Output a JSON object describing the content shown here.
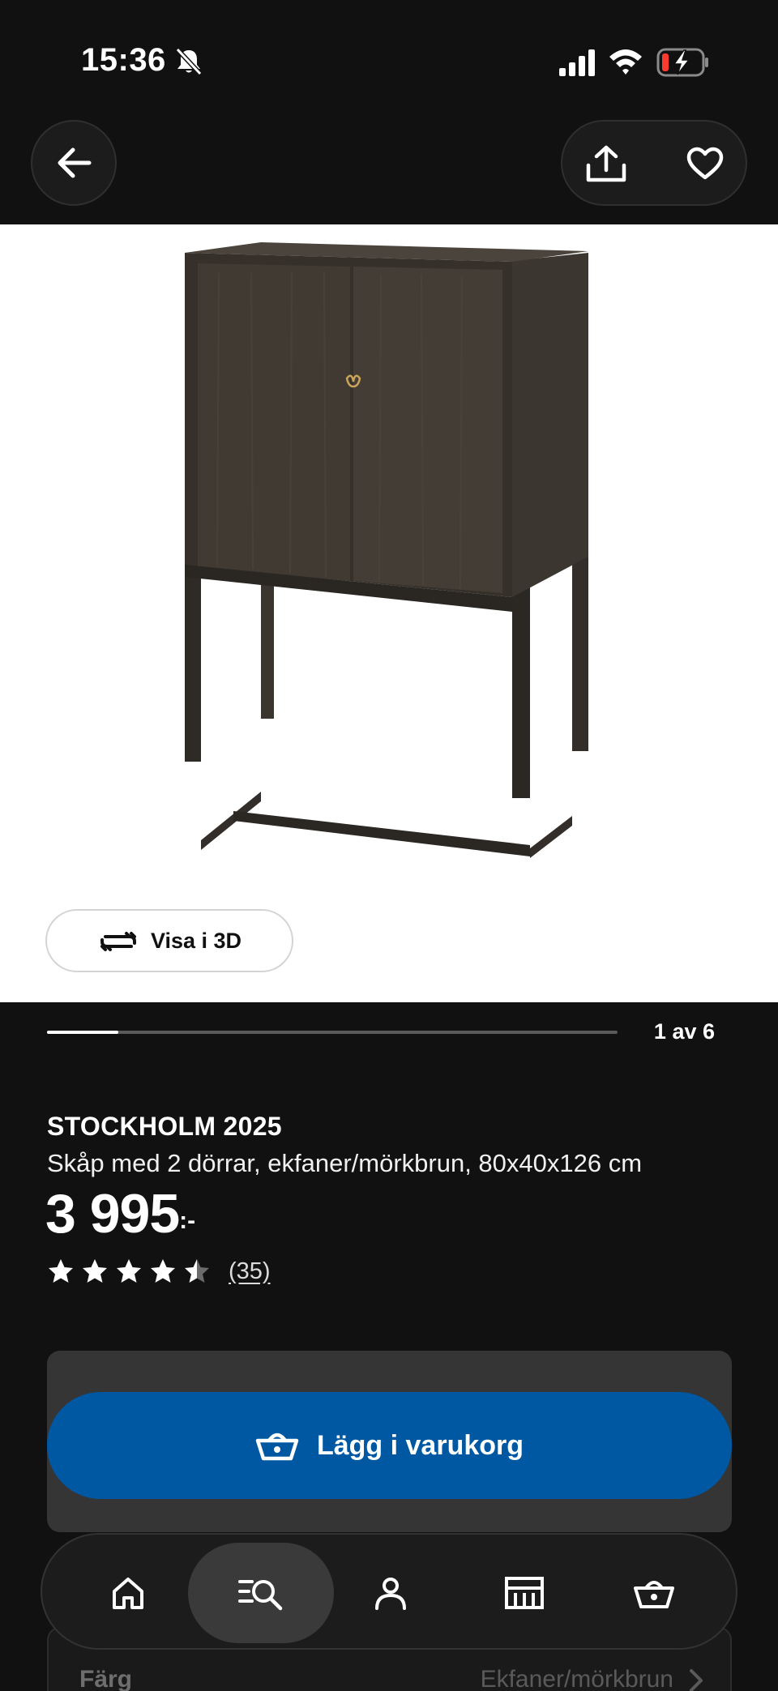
{
  "status_bar": {
    "time": "15:36"
  },
  "header": {
    "back_icon": "arrow-left-icon",
    "share_icon": "share-icon",
    "favorite_icon": "heart-icon"
  },
  "gallery": {
    "view_3d_label": "Visa i 3D",
    "counter": "1 av 6",
    "progress": 0.125
  },
  "product": {
    "name": "STOCKHOLM 2025",
    "description": "Skåp med 2 dörrar, ekfaner/mörkbrun, 80x40x126 cm",
    "price": "3 995",
    "price_suffix": ":-",
    "rating": 4.5,
    "rating_max": 5,
    "review_count": "(35)"
  },
  "cart": {
    "add_label": "Lägg i varukorg",
    "button_color": "#0058a3"
  },
  "color_option": {
    "label": "Färg",
    "value": "Ekfaner/mörkbrun"
  },
  "bottom_nav": {
    "items": [
      {
        "icon": "home-icon",
        "active": false
      },
      {
        "icon": "search-icon",
        "active": true
      },
      {
        "icon": "profile-icon",
        "active": false
      },
      {
        "icon": "store-icon",
        "active": false
      },
      {
        "icon": "cart-icon",
        "active": false
      }
    ]
  }
}
